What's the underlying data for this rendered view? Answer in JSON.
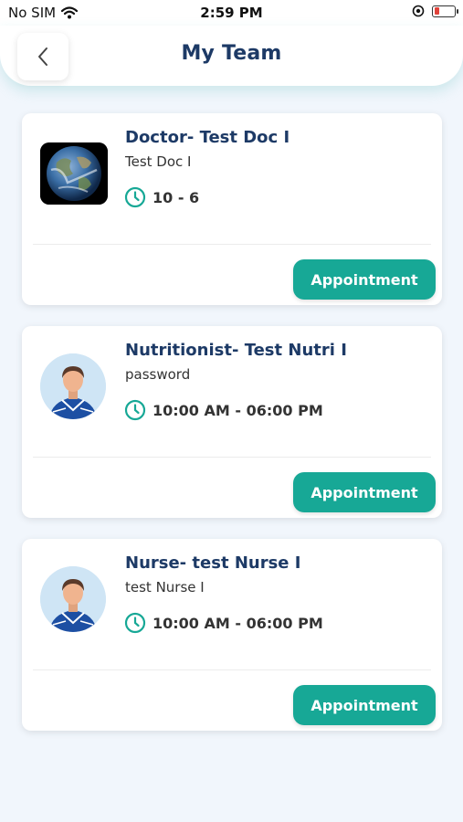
{
  "status_bar": {
    "carrier": "No SIM",
    "time": "2:59 PM"
  },
  "header": {
    "title": "My Team"
  },
  "team": [
    {
      "title": "Doctor- Test Doc I",
      "subtitle": "Test Doc I",
      "time": "10 - 6",
      "button_label": "Appointment",
      "avatar": "earth-photo"
    },
    {
      "title": "Nutritionist- Test Nutri I",
      "subtitle": "password",
      "time": "10:00 AM - 06:00 PM",
      "button_label": "Appointment",
      "avatar": "person-avatar"
    },
    {
      "title": "Nurse- test Nurse I",
      "subtitle": "test Nurse I",
      "time": "10:00 AM - 06:00 PM",
      "button_label": "Appointment",
      "avatar": "person-avatar"
    }
  ],
  "colors": {
    "accent": "#17a896",
    "title": "#1d3a66",
    "background": "#f1f6fc"
  }
}
